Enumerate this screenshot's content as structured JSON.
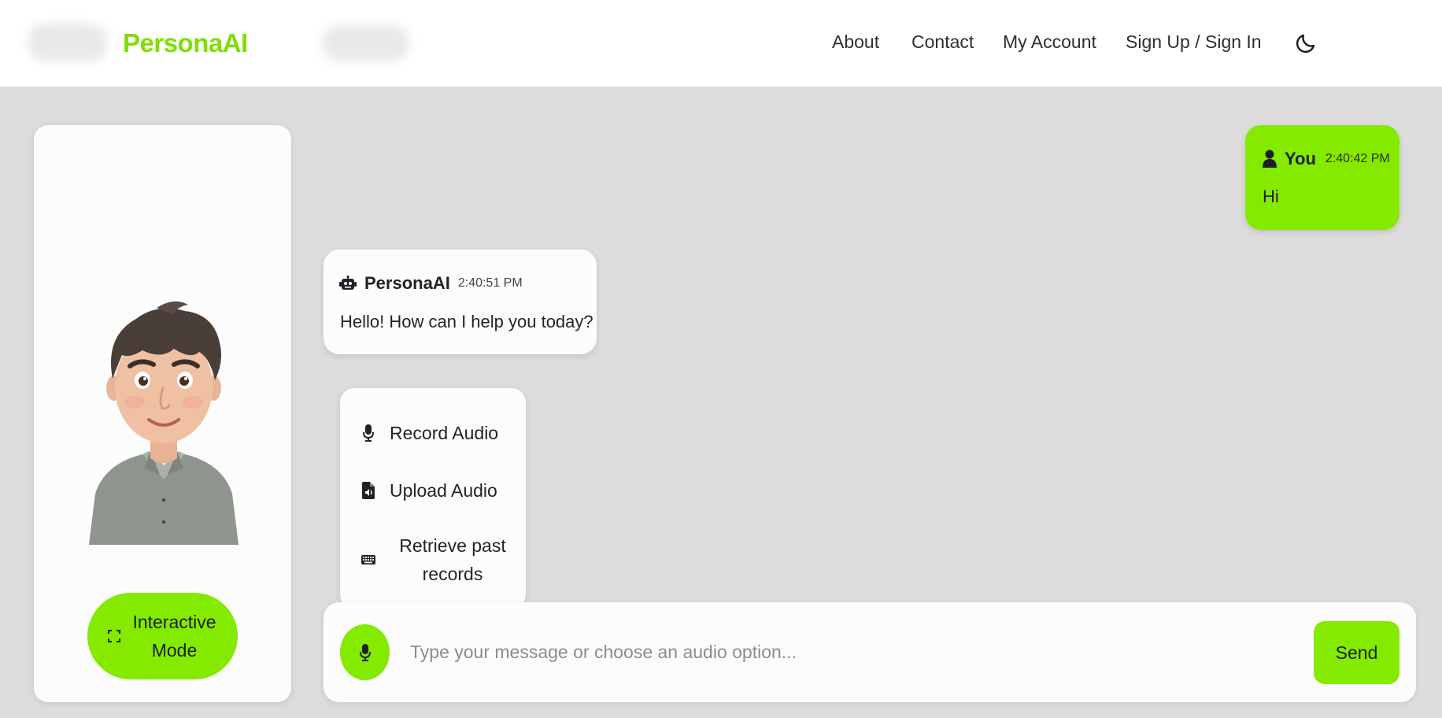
{
  "app": {
    "brand": "PersonaAI"
  },
  "nav": {
    "items": [
      {
        "label": "About"
      },
      {
        "label": "Contact"
      },
      {
        "label": "My Account"
      },
      {
        "label": "Sign Up / Sign In"
      }
    ],
    "theme_toggle_icon": "moon-icon"
  },
  "persona": {
    "avatar_icon": "persona-avatar",
    "interactive_mode_label": "Interactive\nMode",
    "interactive_mode_icon": "expand-icon"
  },
  "messages": [
    {
      "sender": "You",
      "time": "2:40:42 PM",
      "text": "Hi",
      "icon": "user-icon"
    },
    {
      "sender": "PersonaAI",
      "time": "2:40:51 PM",
      "text": "Hello! How can I help you today?",
      "icon": "robot-icon"
    }
  ],
  "audio_menu": {
    "items": [
      {
        "label": "Record Audio",
        "icon": "microphone-icon"
      },
      {
        "label": "Upload Audio",
        "icon": "audio-file-icon"
      },
      {
        "label": "Retrieve past\nrecords",
        "icon": "keyboard-icon"
      }
    ]
  },
  "composer": {
    "placeholder": "Type your message or choose an audio option...",
    "value": "",
    "send_label": "Send",
    "mic_icon": "microphone-icon"
  },
  "colors": {
    "accent": "#84ea00",
    "brand": "#7ee000",
    "page_bg": "#dcdcdc",
    "card_bg": "#fcfcfc"
  }
}
